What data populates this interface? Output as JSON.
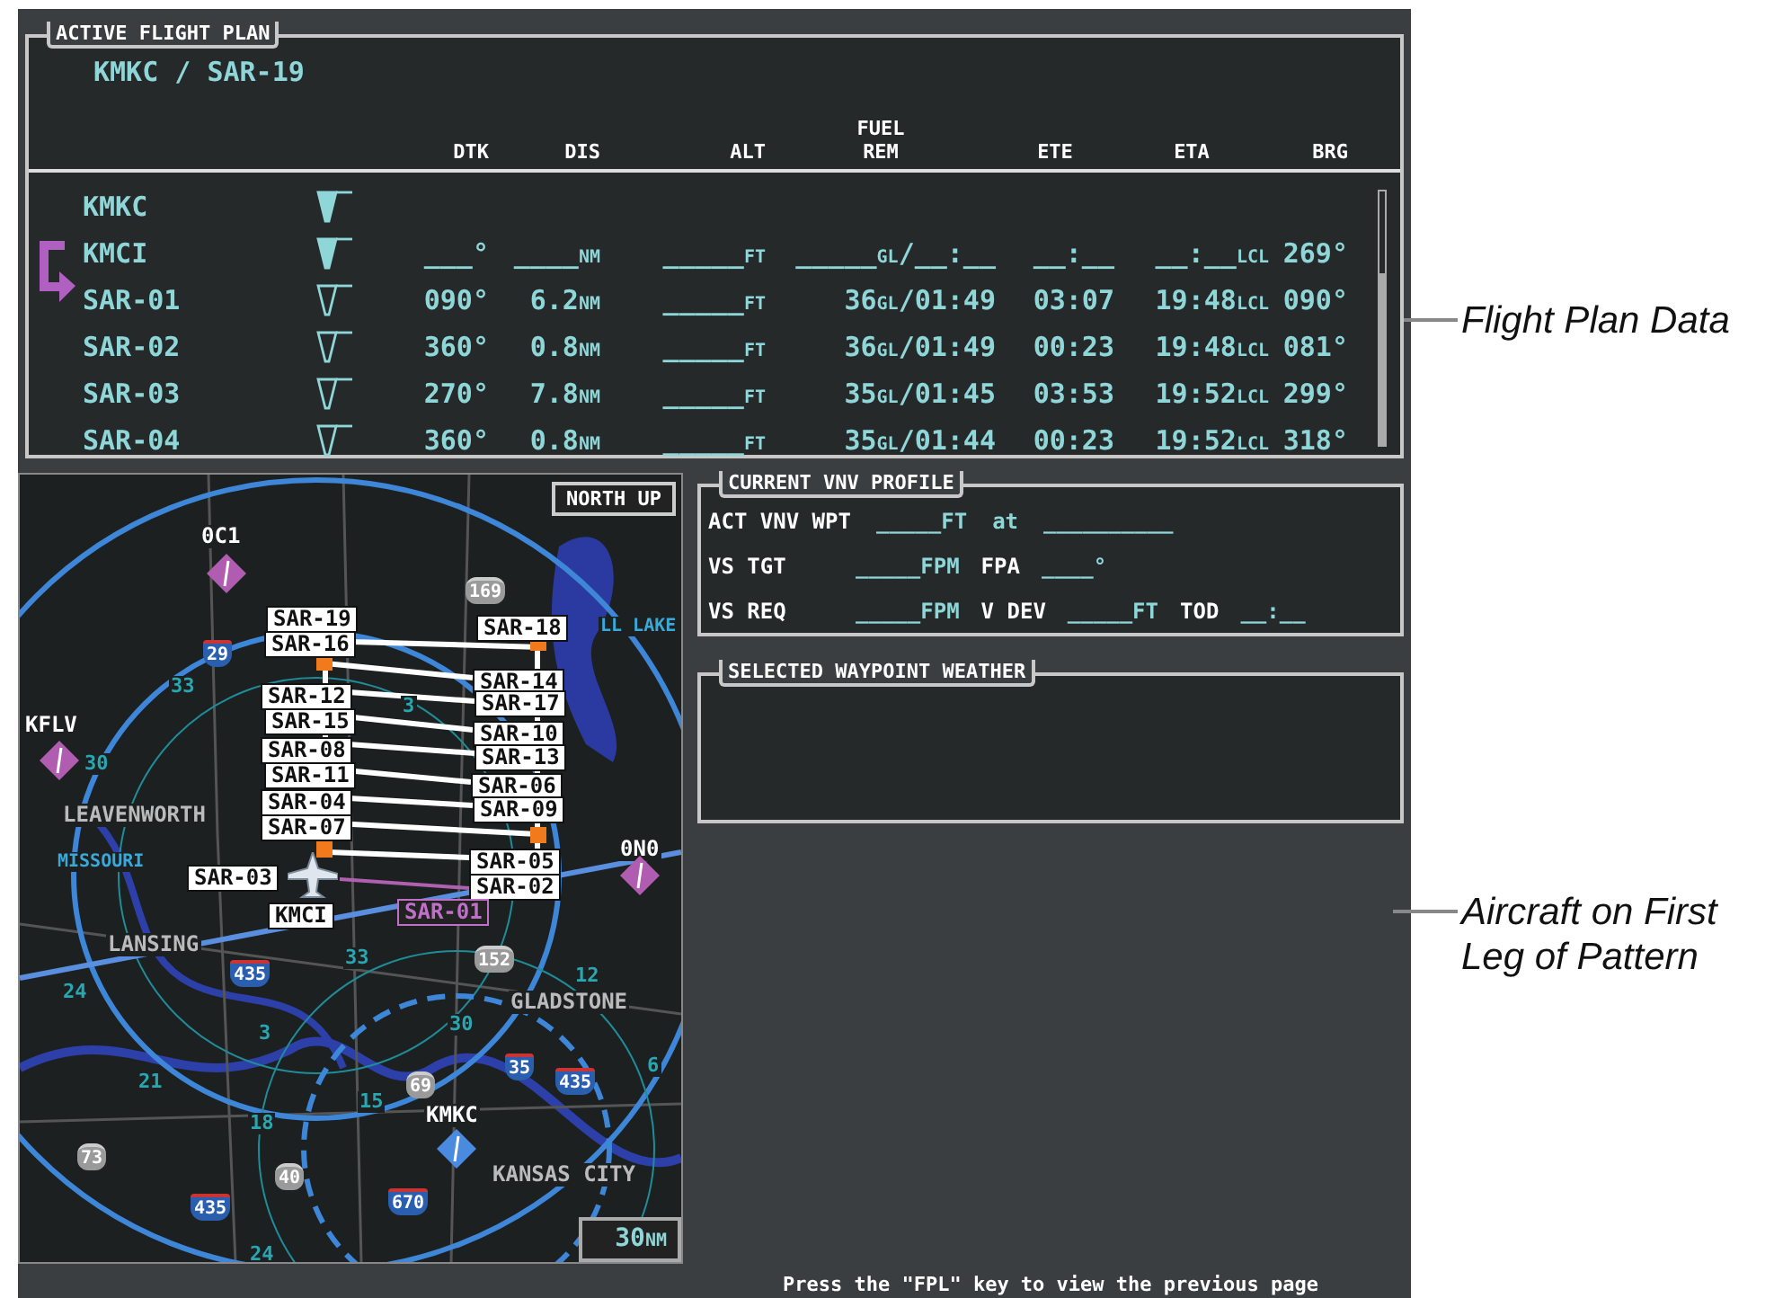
{
  "flight_plan": {
    "title": "ACTIVE FLIGHT PLAN",
    "route": "KMKC / SAR-19",
    "columns": [
      [
        "DTK"
      ],
      [
        "DIS"
      ],
      [
        "ALT"
      ],
      [
        "FUEL",
        "REM"
      ],
      [
        "ETE"
      ],
      [
        "ETA"
      ],
      [
        "BRG"
      ]
    ],
    "rows": [
      {
        "waypoint": "KMKC",
        "filled": true,
        "active": false
      },
      {
        "waypoint": "KMCI",
        "filled": true,
        "active": false,
        "dtk": "___°",
        "dis": "____",
        "dis_unit": "NM",
        "alt": "_____",
        "alt_unit": "FT",
        "fuel": "_____",
        "fuel_unit": "GL",
        "fuel_time": "/__:__",
        "ete": "__:__",
        "eta": "__:__",
        "eta_unit": "LCL",
        "brg": "269°"
      },
      {
        "waypoint": "SAR-01",
        "filled": false,
        "active": true,
        "dtk": "090°",
        "dis": "6.2",
        "dis_unit": "NM",
        "alt": "_____",
        "alt_unit": "FT",
        "fuel": "36",
        "fuel_unit": "GL",
        "fuel_time": "/01:49",
        "ete": "03:07",
        "eta": "19:48",
        "eta_unit": "LCL",
        "brg": "090°"
      },
      {
        "waypoint": "SAR-02",
        "filled": false,
        "active": false,
        "dtk": "360°",
        "dis": "0.8",
        "dis_unit": "NM",
        "alt": "_____",
        "alt_unit": "FT",
        "fuel": "36",
        "fuel_unit": "GL",
        "fuel_time": "/01:49",
        "ete": "00:23",
        "eta": "19:48",
        "eta_unit": "LCL",
        "brg": "081°"
      },
      {
        "waypoint": "SAR-03",
        "filled": false,
        "active": false,
        "dtk": "270°",
        "dis": "7.8",
        "dis_unit": "NM",
        "alt": "_____",
        "alt_unit": "FT",
        "fuel": "35",
        "fuel_unit": "GL",
        "fuel_time": "/01:45",
        "ete": "03:53",
        "eta": "19:52",
        "eta_unit": "LCL",
        "brg": "299°"
      },
      {
        "waypoint": "SAR-04",
        "filled": false,
        "active": false,
        "dtk": "360°",
        "dis": "0.8",
        "dis_unit": "NM",
        "alt": "_____",
        "alt_unit": "FT",
        "fuel": "35",
        "fuel_unit": "GL",
        "fuel_time": "/01:44",
        "ete": "00:23",
        "eta": "19:52",
        "eta_unit": "LCL",
        "brg": "318°"
      }
    ]
  },
  "map": {
    "orientation": "NORTH UP",
    "range": "30",
    "range_unit": "NM",
    "airports": [
      {
        "id": "0C1",
        "kind": "nontowered"
      },
      {
        "id": "KFLV",
        "kind": "nontowered"
      },
      {
        "id": "0N0",
        "kind": "nontowered"
      },
      {
        "id": "KMKC",
        "kind": "towered"
      }
    ],
    "waypoints": [
      {
        "label": "SAR-19",
        "active": false
      },
      {
        "label": "SAR-18",
        "active": false
      },
      {
        "label": "SAR-16",
        "active": false
      },
      {
        "label": "SAR-14",
        "active": false
      },
      {
        "label": "SAR-12",
        "active": false
      },
      {
        "label": "SAR-17",
        "active": false
      },
      {
        "label": "SAR-15",
        "active": false
      },
      {
        "label": "SAR-10",
        "active": false
      },
      {
        "label": "SAR-08",
        "active": false
      },
      {
        "label": "SAR-13",
        "active": false
      },
      {
        "label": "SAR-11",
        "active": false
      },
      {
        "label": "SAR-06",
        "active": false
      },
      {
        "label": "SAR-04",
        "active": false
      },
      {
        "label": "SAR-09",
        "active": false
      },
      {
        "label": "SAR-07",
        "active": false
      },
      {
        "label": "SAR-05",
        "active": false
      },
      {
        "label": "SAR-03",
        "active": false
      },
      {
        "label": "SAR-02",
        "active": false
      },
      {
        "label": "KMCI",
        "active": false
      },
      {
        "label": "SAR-01",
        "active": true
      }
    ],
    "places": [
      "LL LAKE",
      "LEAVENWORTH",
      "MISSOURI",
      "LANSING",
      "GLADSTONE",
      "KANSAS CITY"
    ],
    "shields": [
      {
        "number": "169",
        "kind": "us"
      },
      {
        "number": "29",
        "kind": "interstate"
      },
      {
        "number": "152",
        "kind": "us"
      },
      {
        "number": "435",
        "kind": "interstate"
      },
      {
        "number": "35",
        "kind": "interstate"
      },
      {
        "number": "435",
        "kind": "interstate"
      },
      {
        "number": "69",
        "kind": "us"
      },
      {
        "number": "73",
        "kind": "us"
      },
      {
        "number": "40",
        "kind": "us"
      },
      {
        "number": "435",
        "kind": "interstate"
      },
      {
        "number": "670",
        "kind": "interstate"
      }
    ],
    "compass_labels": [
      "33",
      "3",
      "30",
      "24",
      "33",
      "3",
      "30",
      "12",
      "21",
      "6",
      "15",
      "18",
      "24"
    ]
  },
  "vnv_profile": {
    "title": "CURRENT VNV PROFILE",
    "rows": [
      [
        {
          "text": "ACT VNV WPT",
          "kind": "label"
        },
        {
          "text": "_____FT",
          "kind": "value"
        },
        {
          "text": "at",
          "kind": "value"
        },
        {
          "text": "__________",
          "kind": "value"
        }
      ],
      [
        {
          "text": "VS TGT",
          "kind": "label"
        },
        {
          "text": "_____FPM",
          "kind": "value"
        },
        {
          "text": "FPA",
          "kind": "label"
        },
        {
          "text": "____°",
          "kind": "value"
        }
      ],
      [
        {
          "text": "VS REQ",
          "kind": "label"
        },
        {
          "text": "_____FPM",
          "kind": "value"
        },
        {
          "text": "V DEV",
          "kind": "label"
        },
        {
          "text": "_____FT",
          "kind": "value"
        },
        {
          "text": "TOD",
          "kind": "label"
        },
        {
          "text": "__:__",
          "kind": "value"
        }
      ]
    ]
  },
  "waypoint_weather": {
    "title": "SELECTED WAYPOINT WEATHER"
  },
  "message": "Press the \"FPL\" key to view the previous page",
  "callouts": [
    {
      "text": "Flight Plan Data"
    },
    {
      "text": "Aircraft on First Leg of Pattern"
    }
  ]
}
